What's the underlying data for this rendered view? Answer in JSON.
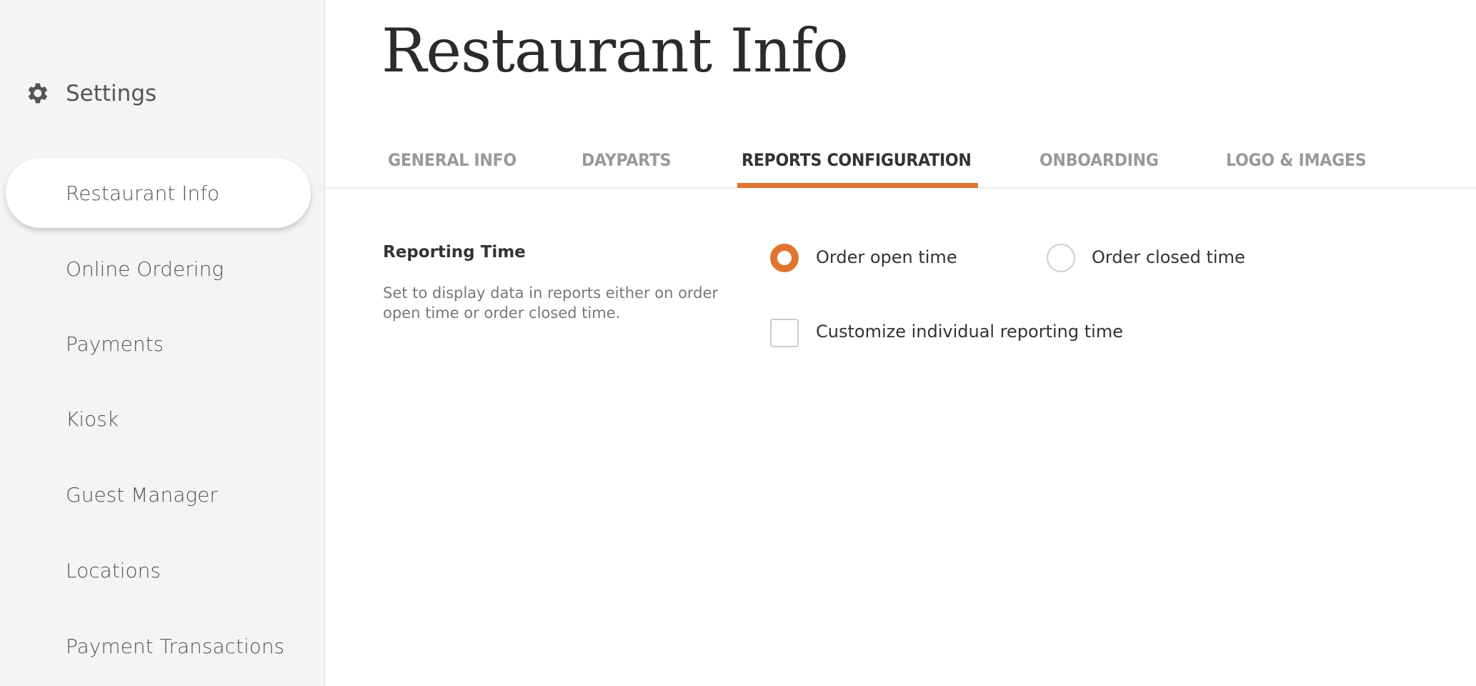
{
  "sidebar": {
    "header": "Settings",
    "items": [
      {
        "label": "Restaurant Info",
        "active": true
      },
      {
        "label": "Online Ordering"
      },
      {
        "label": "Payments"
      },
      {
        "label": "Kiosk"
      },
      {
        "label": "Guest Manager"
      },
      {
        "label": "Locations"
      },
      {
        "label": "Payment Transactions"
      }
    ]
  },
  "page": {
    "title": "Restaurant Info"
  },
  "tabs": [
    {
      "label": "GENERAL INFO"
    },
    {
      "label": "DAYPARTS"
    },
    {
      "label": "REPORTS CONFIGURATION",
      "active": true
    },
    {
      "label": "ONBOARDING"
    },
    {
      "label": "LOGO & IMAGES"
    }
  ],
  "reporting": {
    "title": "Reporting Time",
    "description": "Set to display data in reports either on order open time or order closed time.",
    "options": [
      {
        "label": "Order open time",
        "selected": true
      },
      {
        "label": "Order closed time",
        "selected": false
      }
    ],
    "customize_label": "Customize individual reporting time",
    "customize_checked": false
  },
  "colors": {
    "accent": "#e07530",
    "sidebar_bg": "#f3f4f6"
  }
}
